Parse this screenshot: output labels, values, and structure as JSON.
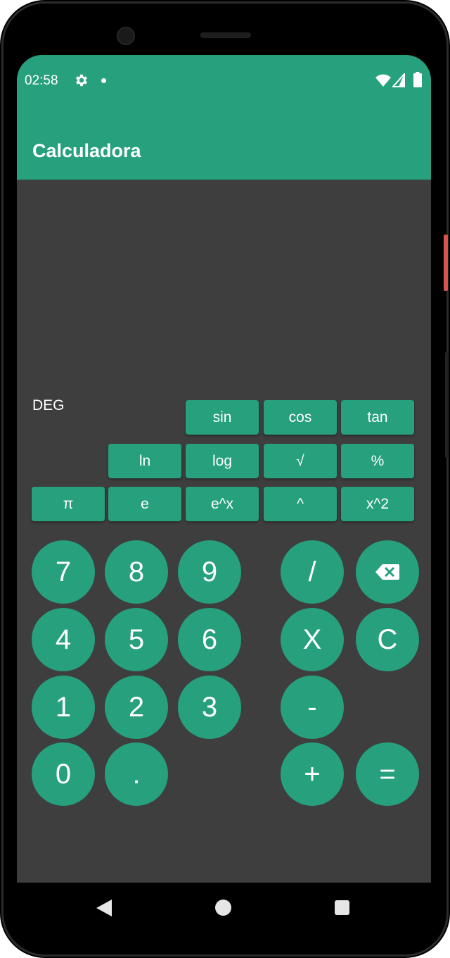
{
  "status_bar": {
    "time": "02:58",
    "icons": [
      "gear-icon",
      "notification-dot-icon",
      "wifi-icon",
      "signal-icon",
      "battery-icon"
    ]
  },
  "app": {
    "title": "Calculadora",
    "mode": "DEG",
    "accent_color": "#26a07d",
    "background_color": "#3e3e3e"
  },
  "scientific": {
    "row1": [
      "sin",
      "cos",
      "tan"
    ],
    "row2": [
      "ln",
      "log",
      "√",
      "%"
    ],
    "row3": [
      "π",
      "e",
      "e^x",
      "^",
      "x^2"
    ]
  },
  "keypad": {
    "digits": [
      "7",
      "8",
      "9",
      "4",
      "5",
      "6",
      "1",
      "2",
      "3",
      "0",
      "."
    ],
    "divide": "/",
    "multiply": "X",
    "subtract": "-",
    "add": "+",
    "equals": "=",
    "clear": "C",
    "backspace_icon": "backspace-icon"
  },
  "navigation": {
    "icons": [
      "back-icon",
      "home-icon",
      "recents-icon"
    ]
  }
}
